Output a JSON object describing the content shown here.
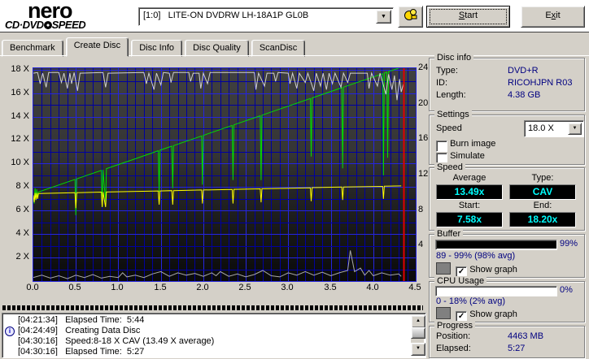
{
  "header": {
    "logo": {
      "title": "nero",
      "subtitle_pre": "CD·DVD",
      "subtitle_post": "SPEED"
    },
    "drive_select": {
      "value": "[1:0]   LITE-ON DVDRW LH-18A1P GL0B"
    },
    "buttons": {
      "start": {
        "pre": "",
        "key": "S",
        "rest": "tart"
      },
      "exit": {
        "pre": "E",
        "key": "x",
        "rest": "it"
      }
    }
  },
  "tabs": [
    {
      "label": "Benchmark",
      "active": false
    },
    {
      "label": "Create Disc",
      "active": true
    },
    {
      "label": "Disc Info",
      "active": false
    },
    {
      "label": "Disc Quality",
      "active": false
    },
    {
      "label": "ScanDisc",
      "active": false
    }
  ],
  "chart_data": {
    "type": "line",
    "x_unit": "GB",
    "xlim": [
      0,
      4.5
    ],
    "x_tick_values": [
      0,
      0.5,
      1.0,
      1.5,
      2.0,
      2.5,
      3.0,
      3.5,
      4.0,
      4.5
    ],
    "x_tick_labels": [
      "0.0",
      "0.5",
      "1.0",
      "1.5",
      "2.0",
      "2.5",
      "3.0",
      "3.5",
      "4.0",
      "4.5"
    ],
    "left_axis": {
      "lim": [
        0,
        18.12
      ],
      "tick_values": [
        18,
        16,
        14,
        12,
        10,
        8,
        6,
        4,
        2
      ],
      "tick_labels": [
        "18 X",
        "16 X",
        "14 X",
        "12 X",
        "10 X",
        "8 X",
        "6 X",
        "4 X",
        "2 X"
      ]
    },
    "right_axis": {
      "lim": [
        0,
        24
      ],
      "tick_values": [
        24,
        20,
        16,
        12,
        8,
        4
      ],
      "tick_labels": [
        "24",
        "20",
        "16",
        "12",
        "8",
        "4"
      ]
    },
    "grid": {
      "minor_step_x": 0.1,
      "major_step_x": 0.5,
      "minor_step_y": 1,
      "major_step_y": 2,
      "minor_color": "#0000a0",
      "major_color": "#2525e0"
    },
    "position_line": {
      "x": 4.36,
      "color": "#e00000"
    },
    "series": [
      {
        "name": "write-speed",
        "color": "#00dd00",
        "axis": "left",
        "points": [
          [
            0.0,
            7.3
          ],
          [
            0.01,
            6.6
          ],
          [
            0.02,
            7.9
          ],
          [
            0.03,
            6.9
          ],
          [
            0.04,
            7.8
          ],
          [
            0.05,
            7.1
          ],
          [
            0.06,
            7.58
          ],
          [
            0.2,
            7.93
          ],
          [
            0.49,
            8.65
          ],
          [
            0.5,
            5.6
          ],
          [
            0.51,
            8.7
          ],
          [
            0.8,
            9.42
          ],
          [
            0.81,
            6.3
          ],
          [
            0.82,
            9.47
          ],
          [
            0.85,
            6.7
          ],
          [
            0.86,
            9.57
          ],
          [
            1.2,
            10.41
          ],
          [
            1.47,
            11.09
          ],
          [
            1.48,
            7.6
          ],
          [
            1.49,
            11.14
          ],
          [
            1.63,
            11.48
          ],
          [
            1.64,
            7.9
          ],
          [
            1.65,
            11.53
          ],
          [
            1.98,
            12.35
          ],
          [
            1.99,
            8.2
          ],
          [
            2.0,
            12.4
          ],
          [
            2.34,
            13.25
          ],
          [
            2.35,
            8.6
          ],
          [
            2.36,
            13.3
          ],
          [
            2.67,
            14.07
          ],
          [
            2.68,
            8.6
          ],
          [
            2.69,
            14.12
          ],
          [
            3.0,
            14.89
          ],
          [
            3.26,
            15.54
          ],
          [
            3.27,
            10.6
          ],
          [
            3.28,
            15.59
          ],
          [
            3.63,
            16.46
          ],
          [
            3.64,
            9.6
          ],
          [
            3.65,
            16.51
          ],
          [
            3.9,
            17.13
          ],
          [
            4.11,
            17.65
          ],
          [
            4.12,
            9.0
          ],
          [
            4.13,
            17.7
          ],
          [
            4.16,
            17.78
          ],
          [
            4.17,
            10.5
          ],
          [
            4.18,
            17.83
          ],
          [
            4.33,
            18.2
          ]
        ]
      },
      {
        "name": "rotation-speed",
        "color": "#ffff00",
        "axis": "left",
        "points": [
          [
            0.0,
            7.3
          ],
          [
            0.01,
            6.7
          ],
          [
            0.02,
            7.5
          ],
          [
            0.03,
            6.9
          ],
          [
            0.04,
            7.5
          ],
          [
            0.05,
            7.0
          ],
          [
            0.06,
            7.45
          ],
          [
            0.49,
            7.52
          ],
          [
            0.5,
            6.2
          ],
          [
            0.51,
            7.52
          ],
          [
            0.8,
            7.57
          ],
          [
            0.81,
            6.3
          ],
          [
            0.82,
            7.57
          ],
          [
            0.85,
            6.3
          ],
          [
            0.86,
            7.58
          ],
          [
            1.47,
            7.67
          ],
          [
            1.48,
            6.5
          ],
          [
            1.49,
            7.67
          ],
          [
            1.63,
            7.7
          ],
          [
            1.64,
            6.5
          ],
          [
            1.65,
            7.7
          ],
          [
            1.98,
            7.75
          ],
          [
            1.99,
            6.6
          ],
          [
            2.0,
            7.75
          ],
          [
            2.34,
            7.8
          ],
          [
            2.35,
            6.6
          ],
          [
            2.36,
            7.81
          ],
          [
            2.67,
            7.85
          ],
          [
            2.68,
            6.7
          ],
          [
            2.69,
            7.86
          ],
          [
            3.26,
            7.94
          ],
          [
            3.27,
            6.8
          ],
          [
            3.28,
            7.95
          ],
          [
            3.63,
            8.0
          ],
          [
            3.64,
            6.9
          ],
          [
            3.65,
            8.0
          ],
          [
            4.11,
            8.06
          ],
          [
            4.12,
            7.0
          ],
          [
            4.13,
            8.07
          ],
          [
            4.33,
            8.1
          ]
        ]
      },
      {
        "name": "buffer-level",
        "color": "#cfcfcf",
        "axis": "left",
        "points": [
          [
            0.0,
            17.7
          ],
          [
            0.05,
            17.75
          ],
          [
            0.08,
            16.8
          ],
          [
            0.11,
            17.7
          ],
          [
            0.15,
            16.5
          ],
          [
            0.18,
            17.75
          ],
          [
            0.3,
            17.75
          ],
          [
            0.33,
            16.9
          ],
          [
            0.36,
            17.7
          ],
          [
            0.4,
            16.4
          ],
          [
            0.43,
            17.7
          ],
          [
            0.45,
            16.8
          ],
          [
            0.48,
            17.75
          ],
          [
            0.52,
            16.2
          ],
          [
            0.55,
            17.7
          ],
          [
            0.82,
            17.75
          ],
          [
            0.85,
            16.5
          ],
          [
            0.88,
            17.7
          ],
          [
            1.3,
            17.75
          ],
          [
            1.33,
            16.8
          ],
          [
            1.36,
            17.7
          ],
          [
            1.42,
            16.3
          ],
          [
            1.45,
            17.7
          ],
          [
            1.5,
            16.7
          ],
          [
            1.53,
            17.75
          ],
          [
            1.6,
            17.7
          ],
          [
            1.62,
            16.9
          ],
          [
            1.65,
            17.75
          ],
          [
            1.83,
            17.75
          ],
          [
            1.85,
            17.0
          ],
          [
            1.88,
            17.7
          ],
          [
            1.95,
            17.7
          ],
          [
            1.97,
            16.4
          ],
          [
            2.0,
            17.7
          ],
          [
            2.05,
            16.8
          ],
          [
            2.08,
            17.75
          ],
          [
            2.6,
            17.75
          ],
          [
            2.62,
            16.3
          ],
          [
            2.65,
            17.7
          ],
          [
            2.72,
            16.6
          ],
          [
            2.75,
            17.7
          ],
          [
            2.83,
            17.7
          ],
          [
            2.85,
            17.0
          ],
          [
            2.88,
            17.75
          ],
          [
            3.0,
            17.7
          ],
          [
            3.02,
            16.8
          ],
          [
            3.05,
            17.7
          ],
          [
            3.1,
            16.4
          ],
          [
            3.13,
            17.7
          ],
          [
            3.2,
            16.9
          ],
          [
            3.23,
            17.7
          ],
          [
            3.3,
            16.2
          ],
          [
            3.33,
            17.7
          ],
          [
            3.38,
            16.6
          ],
          [
            3.41,
            17.7
          ],
          [
            3.45,
            16.3
          ],
          [
            3.48,
            17.7
          ],
          [
            3.52,
            16.8
          ],
          [
            3.55,
            17.7
          ],
          [
            3.62,
            16.5
          ],
          [
            3.65,
            17.7
          ],
          [
            3.7,
            16.9
          ],
          [
            3.73,
            17.7
          ],
          [
            3.93,
            17.7
          ],
          [
            3.95,
            16.4
          ],
          [
            3.98,
            17.7
          ],
          [
            4.05,
            16.6
          ],
          [
            4.08,
            17.7
          ],
          [
            4.15,
            15.9
          ],
          [
            4.18,
            17.6
          ],
          [
            4.22,
            16.3
          ],
          [
            4.25,
            17.5
          ],
          [
            4.28,
            15.4
          ],
          [
            4.31,
            17.2
          ],
          [
            4.33,
            16.1
          ],
          [
            4.36,
            16.9
          ]
        ]
      },
      {
        "name": "cpu-usage",
        "color": "#a8a8a8",
        "axis": "left",
        "points": [
          [
            0.0,
            0.3
          ],
          [
            0.1,
            0.5
          ],
          [
            0.2,
            0.25
          ],
          [
            0.3,
            0.45
          ],
          [
            0.4,
            0.2
          ],
          [
            0.5,
            0.5
          ],
          [
            0.6,
            0.3
          ],
          [
            0.7,
            0.55
          ],
          [
            0.8,
            0.25
          ],
          [
            0.9,
            0.4
          ],
          [
            1.0,
            0.3
          ],
          [
            1.05,
            0.7
          ],
          [
            1.1,
            0.35
          ],
          [
            1.2,
            0.5
          ],
          [
            1.3,
            0.3
          ],
          [
            1.4,
            0.6
          ],
          [
            1.5,
            0.8
          ],
          [
            1.6,
            0.4
          ],
          [
            1.7,
            0.7
          ],
          [
            1.8,
            0.5
          ],
          [
            1.9,
            0.65
          ],
          [
            2.0,
            0.4
          ],
          [
            2.1,
            0.7
          ],
          [
            2.15,
            0.45
          ],
          [
            2.2,
            0.8
          ],
          [
            2.3,
            0.4
          ],
          [
            2.4,
            0.6
          ],
          [
            2.5,
            0.35
          ],
          [
            2.6,
            0.55
          ],
          [
            2.7,
            0.9
          ],
          [
            2.8,
            0.45
          ],
          [
            2.9,
            0.35
          ],
          [
            3.0,
            0.7
          ],
          [
            3.1,
            0.5
          ],
          [
            3.2,
            0.8
          ],
          [
            3.3,
            0.5
          ],
          [
            3.4,
            0.75
          ],
          [
            3.5,
            0.45
          ],
          [
            3.6,
            0.7
          ],
          [
            3.7,
            0.9
          ],
          [
            3.73,
            2.6
          ],
          [
            3.78,
            0.8
          ],
          [
            3.85,
            1.1
          ],
          [
            3.9,
            0.5
          ],
          [
            3.95,
            0.9
          ],
          [
            4.0,
            0.45
          ],
          [
            4.1,
            0.7
          ],
          [
            4.2,
            0.5
          ],
          [
            4.3,
            0.6
          ],
          [
            4.33,
            0.4
          ]
        ]
      }
    ]
  },
  "panels": {
    "disc_info": {
      "title": "Disc info",
      "rows": [
        {
          "label": "Type:",
          "value": "DVD+R"
        },
        {
          "label": "ID:",
          "value": "RICOHJPN R03"
        },
        {
          "label": "Length:",
          "value": "4.38 GB"
        }
      ]
    },
    "settings": {
      "title": "Settings",
      "speed_label": "Speed",
      "speed_value": "18.0 X",
      "checkboxes": [
        {
          "label": "Burn image",
          "checked": false
        },
        {
          "label": "Simulate",
          "checked": false
        }
      ]
    },
    "speed": {
      "title": "Speed",
      "cells": [
        {
          "label": "Average",
          "value": "13.49x"
        },
        {
          "label": "Type:",
          "value": "CAV"
        },
        {
          "label": "Start:",
          "value": "7.58x"
        },
        {
          "label": "End:",
          "value": "18.20x"
        }
      ],
      "lcd_color": "#00ffff"
    },
    "buffer": {
      "title": "Buffer",
      "percent": "99%",
      "fill": 0.99,
      "range": "89 - 99% (98% avg)",
      "show_graph": "Show graph",
      "checked": true,
      "graph_color": "#808080"
    },
    "cpu": {
      "title": "CPU Usage",
      "percent": "0%",
      "fill": 0,
      "range": "0 - 18% (2% avg)",
      "show_graph": "Show graph",
      "checked": true,
      "graph_color": "#808080"
    },
    "progress": {
      "title": "Progress",
      "rows": [
        {
          "label": "Position:",
          "value": "4463 MB"
        },
        {
          "label": "Elapsed:",
          "value": "5:27"
        }
      ]
    }
  },
  "log": {
    "rows": [
      {
        "time": "[04:21:34]",
        "text": "Elapsed Time:  5:44",
        "icon": false
      },
      {
        "time": "[04:24:49]",
        "text": "Creating Data Disc",
        "icon": true
      },
      {
        "time": "[04:30:16]",
        "text": "Speed:8-18 X CAV (13.49 X average)",
        "icon": false
      },
      {
        "time": "[04:30:16]",
        "text": "Elapsed Time:  5:27",
        "icon": false
      }
    ]
  }
}
